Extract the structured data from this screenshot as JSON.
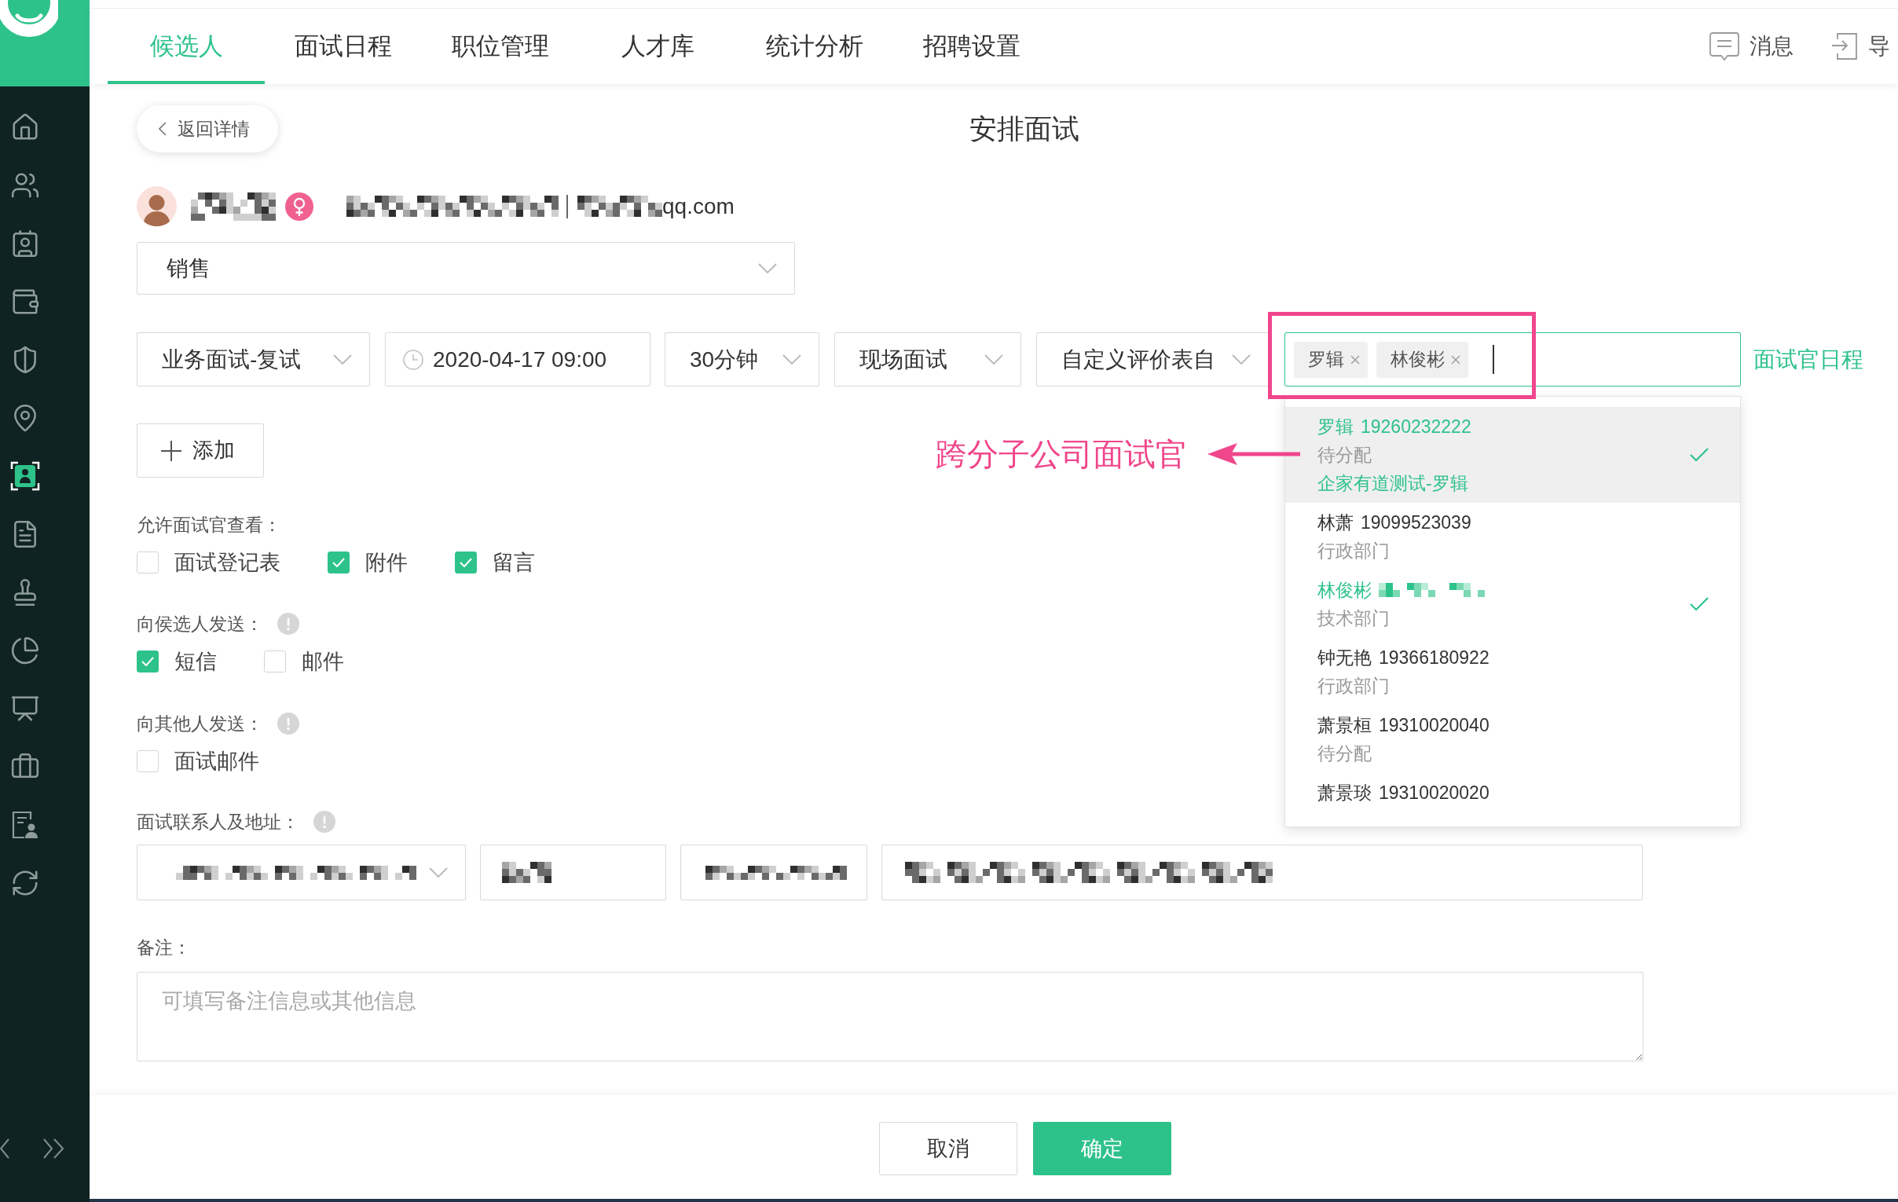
{
  "sidebar": {
    "items": [
      {
        "kind": "home",
        "selected": false
      },
      {
        "kind": "people",
        "selected": false
      },
      {
        "kind": "contacts",
        "selected": false
      },
      {
        "kind": "wallet",
        "selected": false
      },
      {
        "kind": "shield",
        "selected": false
      },
      {
        "kind": "location",
        "selected": false
      },
      {
        "kind": "candidate",
        "selected": true
      },
      {
        "kind": "document",
        "selected": false
      },
      {
        "kind": "stamp",
        "selected": false
      },
      {
        "kind": "pie",
        "selected": false
      },
      {
        "kind": "presentation",
        "selected": false
      },
      {
        "kind": "toolbox",
        "selected": false
      },
      {
        "kind": "profile",
        "selected": false
      },
      {
        "kind": "exchange",
        "selected": false
      }
    ]
  },
  "nav": {
    "tabs": [
      {
        "label": "候选人",
        "selected": true
      },
      {
        "label": "面试日程",
        "selected": false
      },
      {
        "label": "职位管理",
        "selected": false
      },
      {
        "label": "人才库",
        "selected": false
      },
      {
        "label": "统计分析",
        "selected": false
      },
      {
        "label": "招聘设置",
        "selected": false
      }
    ],
    "actions": [
      {
        "kind": "message",
        "label": "消息"
      },
      {
        "kind": "import",
        "label": "导"
      }
    ]
  },
  "header": {
    "back_button": "返回详情",
    "title": "安排面试"
  },
  "candidate": {
    "female": true,
    "email_suffix": "qq.com"
  },
  "job_select": {
    "value": "销售"
  },
  "interview": {
    "round": "业务面试-复试",
    "time": "2020-04-17 09:00",
    "duration": "30分钟",
    "method": "现场面试",
    "evaluation_form": "自定义评价表自",
    "interviewers": [
      {
        "name": "罗辑"
      },
      {
        "name": "林俊彬"
      }
    ],
    "schedule_link": "面试官日程"
  },
  "interviewer_options": [
    {
      "name": "罗辑",
      "phone": "19260232222",
      "phone_redacted": false,
      "department": "待分配",
      "company": "企家有道测试-罗辑",
      "selected": true,
      "highlighted": true
    },
    {
      "name": "林萧",
      "phone": "19099523039",
      "phone_redacted": false,
      "department": "行政部门",
      "selected": false,
      "highlighted": false
    },
    {
      "name": "林俊彬",
      "phone_redacted": true,
      "department": "技术部门",
      "selected": true,
      "highlighted": false
    },
    {
      "name": "钟无艳",
      "phone": "19366180922",
      "phone_redacted": false,
      "department": "行政部门",
      "selected": false,
      "highlighted": false
    },
    {
      "name": "萧景桓",
      "phone": "19310020040",
      "phone_redacted": false,
      "department": "待分配",
      "selected": false,
      "highlighted": false
    },
    {
      "name": "萧景琰",
      "phone": "19310020020",
      "phone_redacted": false,
      "selected": false,
      "highlighted": false
    }
  ],
  "annotation": {
    "text": "跨分子公司面试官"
  },
  "add_button": "添加",
  "sections": [
    {
      "label": "允许面试官查看：",
      "info": false,
      "options": [
        {
          "label": "面试登记表",
          "checked": false
        },
        {
          "label": "附件",
          "checked": true
        },
        {
          "label": "留言",
          "checked": true
        }
      ]
    },
    {
      "label": "向侯选人发送：",
      "info": true,
      "options": [
        {
          "label": "短信",
          "checked": true
        },
        {
          "label": "邮件",
          "checked": false
        }
      ]
    },
    {
      "label": "向其他人发送：",
      "info": true,
      "options": [
        {
          "label": "面试邮件",
          "checked": false
        }
      ]
    }
  ],
  "contact": {
    "label": "面试联系人及地址：",
    "info": true
  },
  "remarks": {
    "label": "备注：",
    "placeholder": "可填写备注信息或其他信息"
  },
  "footer": {
    "buttons": [
      {
        "label": "取消",
        "kind": "secondary"
      },
      {
        "label": "确定",
        "kind": "primary"
      }
    ]
  }
}
